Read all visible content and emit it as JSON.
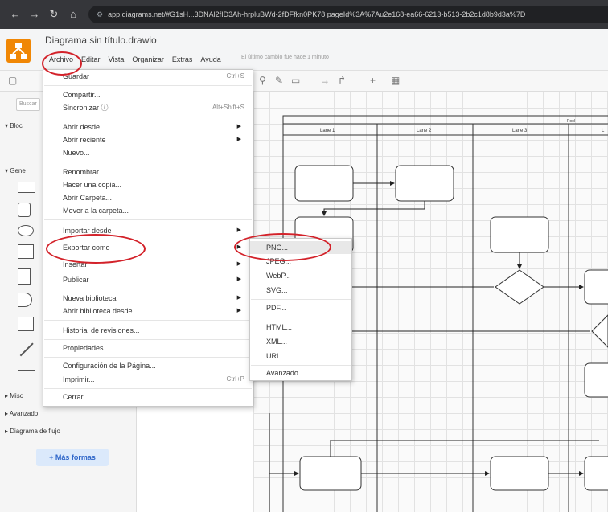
{
  "browser": {
    "url": "app.diagrams.net/#G1sH...3DNAl2fID3Ah-hrpluBWd-2fDFfkn0PK78 pageId%3A%7Au2e168-ea66-6213-b513-2b2c1d8b9d3a%7D"
  },
  "app": {
    "title": "Diagrama sin título.drawio",
    "menus": [
      "Archivo",
      "Editar",
      "Vista",
      "Organizar",
      "Extras",
      "Ayuda"
    ],
    "last_change": "El último cambio fue hace 1 minuto"
  },
  "sidebar": {
    "search_placeholder": "Buscar",
    "sections": [
      "Bloc",
      "Gene",
      "Misc",
      "Avanzado",
      "Diagrama de flujo"
    ],
    "more_shapes": "+ Más formas"
  },
  "archivo_menu": {
    "items": [
      {
        "label": "Guardar",
        "shortcut": "Ctrl+S"
      },
      {
        "label": "Compartir..."
      },
      {
        "label": "Sincronizar ⓘ",
        "shortcut": "Alt+Shift+S"
      },
      {
        "label": "Abrir desde"
      },
      {
        "label": "Abrir reciente"
      },
      {
        "label": "Nuevo..."
      },
      {
        "label": "Renombrar..."
      },
      {
        "label": "Hacer una copia..."
      },
      {
        "label": "Abrir Carpeta..."
      },
      {
        "label": "Mover a la carpeta..."
      },
      {
        "label": "Importar desde"
      },
      {
        "label": "Exportar como"
      },
      {
        "label": "Insertar"
      },
      {
        "label": "Publicar"
      },
      {
        "label": "Nueva biblioteca"
      },
      {
        "label": "Abrir biblioteca desde"
      },
      {
        "label": "Historial de revisiones..."
      },
      {
        "label": "Propiedades..."
      },
      {
        "label": "Configuración de la Página..."
      },
      {
        "label": "Imprimir...",
        "shortcut": "Ctrl+P"
      },
      {
        "label": "Cerrar"
      }
    ]
  },
  "export_menu": {
    "items": [
      "PNG...",
      "JPEG...",
      "WebP...",
      "SVG...",
      "PDF...",
      "HTML...",
      "XML...",
      "URL...",
      "Avanzado..."
    ]
  },
  "diagram": {
    "pool_label": "Pool",
    "lanes": [
      "Lane 1",
      "Lane 2",
      "Lane 3",
      "L"
    ]
  }
}
